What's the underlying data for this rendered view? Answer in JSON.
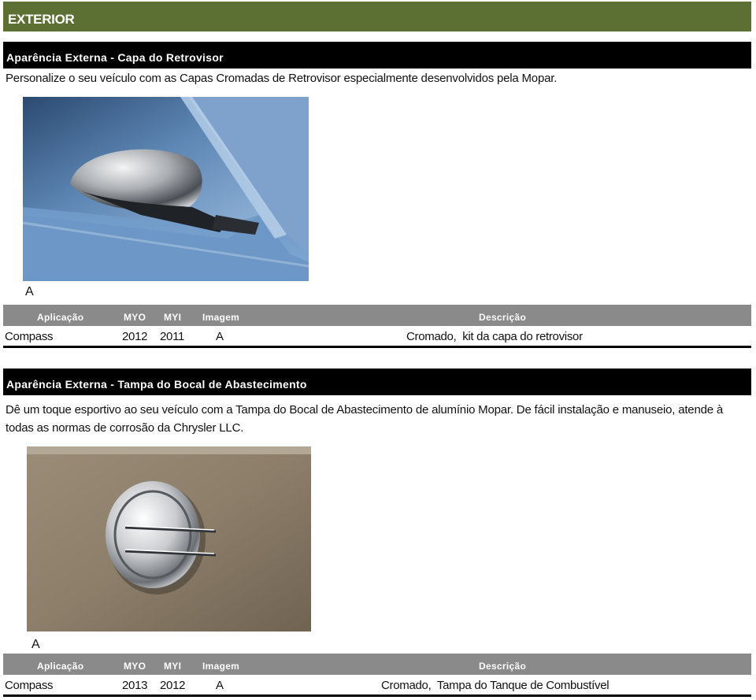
{
  "header": {
    "title": "EXTERIOR"
  },
  "columns": {
    "aplicacao": "Aplicação",
    "myo": "MYO",
    "myi": "MYI",
    "imagem": "Imagem",
    "descricao": "Descrição"
  },
  "sections": [
    {
      "title": "Aparência Externa - Capa do Retrovisor",
      "description": "Personalize o seu veículo com as Capas Cromadas de Retrovisor especialmente desenvolvidos pela Mopar.",
      "image_letter": "A",
      "row": {
        "aplicacao": "Compass",
        "myo": "2012",
        "myi": "2011",
        "imagem": "A",
        "descricao": "Cromado,  kit da capa do retrovisor"
      }
    },
    {
      "title": "Aparência Externa - Tampa do Bocal de Abastecimento",
      "description": "Dê um toque esportivo ao seu veículo com a Tampa do Bocal de Abastecimento de alumínio Mopar. De fácil instalação e manuseio, atende à todas as normas de corrosão da Chrysler LLC.",
      "image_letter": "A",
      "row": {
        "aplicacao": "Compass",
        "myo": "2013",
        "myi": "2012",
        "imagem": "A",
        "descricao": "Cromado,  Tampa do Tanque de Combustível"
      }
    }
  ]
}
